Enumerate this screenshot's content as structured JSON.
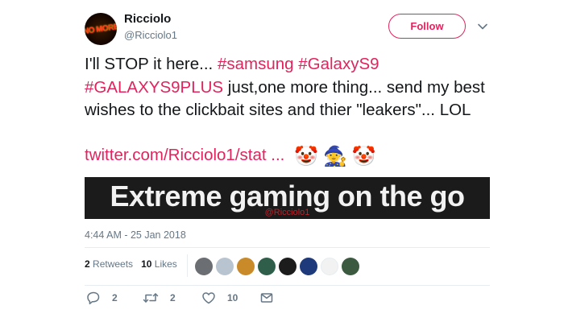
{
  "user": {
    "display_name": "Ricciolo",
    "handle": "@Ricciolo1",
    "avatar_text": "NO MORE"
  },
  "follow_label": "Follow",
  "tweet": {
    "segments": [
      {
        "text": "I'll STOP it here... ",
        "hl": false
      },
      {
        "text": "#samsung",
        "hl": true
      },
      {
        "text": " ",
        "hl": false
      },
      {
        "text": "#GalaxyS9",
        "hl": true
      },
      {
        "text": " ",
        "hl": false
      },
      {
        "text": "#GALAXYS9PLUS",
        "hl": true
      },
      {
        "text": " just,one more thing... send my best wishes to the clickbait sites and thier \"leakers\"... LOL",
        "hl": false
      }
    ],
    "link": "twitter.com/Ricciolo1/stat ...",
    "emojis": [
      "clown-face",
      "mage",
      "clown-face"
    ]
  },
  "media": {
    "title": "Extreme gaming on the go",
    "watermark": "@Ricciolo1"
  },
  "timestamp": "4:44 AM - 25 Jan 2018",
  "stats": {
    "retweets_count": "2",
    "retweets_label": "Retweets",
    "likes_count": "10",
    "likes_label": "Likes"
  },
  "likers": [
    {
      "color": "#6b6e73"
    },
    {
      "color": "#b8c4d0"
    },
    {
      "color": "#c98a2a"
    },
    {
      "color": "#2f5f4a"
    },
    {
      "color": "#1c1c1c"
    },
    {
      "color": "#1f3a7a"
    },
    {
      "color": "#f2f2f2"
    },
    {
      "color": "#3c5a3f"
    }
  ],
  "actions": {
    "reply_count": "2",
    "retweet_count": "2",
    "like_count": "10"
  },
  "colors": {
    "accent": "#e0245e",
    "muted": "#657786"
  }
}
